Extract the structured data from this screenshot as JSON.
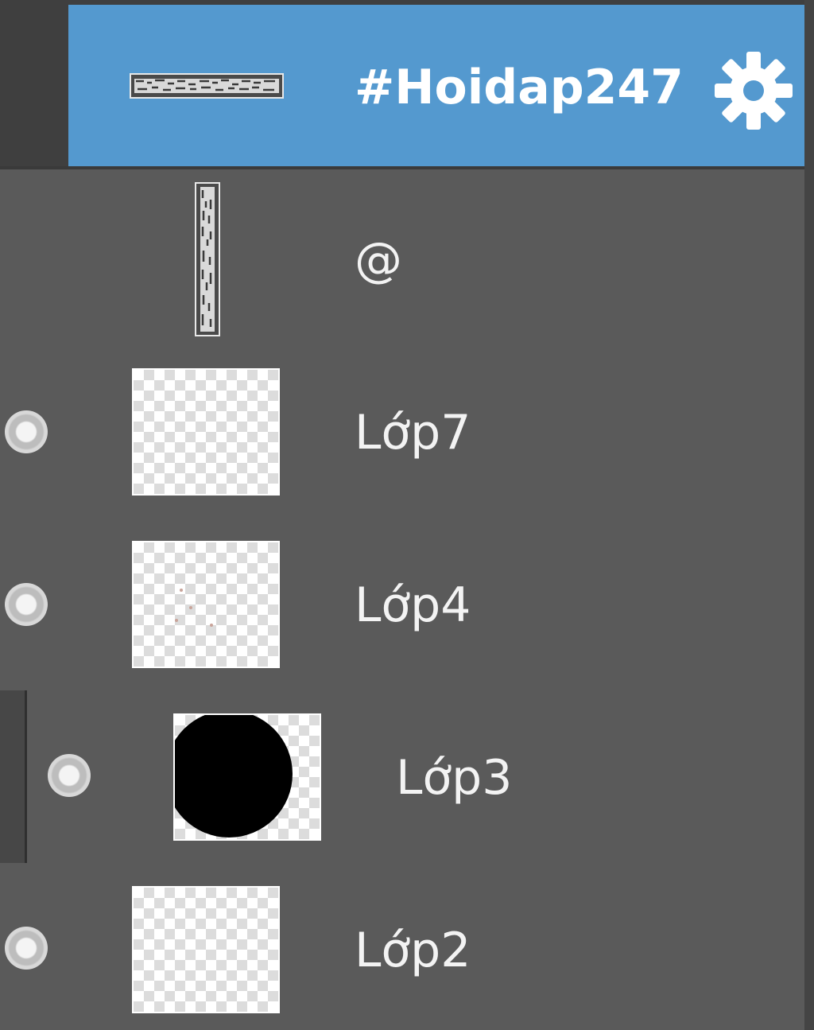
{
  "layers_panel": {
    "layers": [
      {
        "name": "#Hoidap247",
        "kind": "text",
        "selected": true,
        "has_settings": true,
        "thumb_icon": "text-strip-horizontal"
      },
      {
        "name": "@",
        "kind": "text",
        "selected": false,
        "thumb_icon": "text-strip-vertical"
      },
      {
        "name": "Lớp7",
        "kind": "raster",
        "selected": false,
        "thumb_icon": "transparent-thumbnail"
      },
      {
        "name": "Lớp4",
        "kind": "raster",
        "selected": false,
        "thumb_icon": "transparent-thumbnail"
      },
      {
        "name": "Lớp3",
        "kind": "raster",
        "selected": false,
        "clipped": true,
        "thumb_icon": "black-circle-thumbnail"
      },
      {
        "name": "Lớp2",
        "kind": "raster",
        "selected": false,
        "thumb_icon": "transparent-thumbnail"
      }
    ],
    "colors": {
      "panel_bg": "#5a5a5a",
      "selected_bg": "#5499cf",
      "row_border": "#3c3c3c",
      "label_text": "#f3f3f3"
    },
    "icons": {
      "settings": "gear-icon",
      "visibility": "visibility-toggle-icon"
    }
  }
}
